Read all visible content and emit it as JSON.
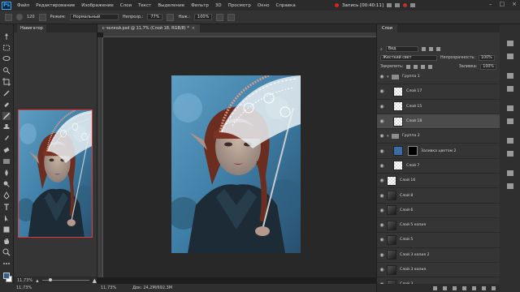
{
  "app": {
    "logo": "Ps"
  },
  "menu": [
    "Файл",
    "Редактирование",
    "Изображение",
    "Слои",
    "Текст",
    "Выделение",
    "Фильтр",
    "3D",
    "Просмотр",
    "Окно",
    "Справка"
  ],
  "recording": {
    "label": "Запись [00:40:11]"
  },
  "options": {
    "mode_label": "Режим:",
    "mode_value": "Нормальный",
    "opacity_label": "Непрозр.:",
    "opacity_value": "77%",
    "pressure_label": "Наж.:",
    "pressure_value": "100%",
    "brush_size": "120"
  },
  "navigator": {
    "tab": "Навигатор",
    "zoom": "11,73%"
  },
  "document": {
    "tab": "с челкой.psd @ 11,7% (Слой 18, RGB/8) *",
    "zoom": "11,73%",
    "doc_size": "Док: 24,2М/692,3М"
  },
  "layers": {
    "tab": "Слои",
    "kind": "Вид",
    "blend": "Жесткий свет",
    "opacity_label": "Непрозрачность:",
    "opacity_value": "100%",
    "lock_label": "Закрепить:",
    "fill_label": "Заливка:",
    "fill_value": "100%",
    "items": [
      {
        "name": "Группа 1",
        "type": "group"
      },
      {
        "name": "Слой 17",
        "type": "layer"
      },
      {
        "name": "Слой 15",
        "type": "layer"
      },
      {
        "name": "Слой 18",
        "type": "layer",
        "selected": true
      },
      {
        "name": "Группа 2",
        "type": "group"
      },
      {
        "name": "Заливка цветом 2",
        "type": "fill"
      },
      {
        "name": "Слой 7",
        "type": "layer"
      },
      {
        "name": "Слой 16",
        "type": "layer"
      },
      {
        "name": "Слой 8",
        "type": "layer"
      },
      {
        "name": "Слой 6",
        "type": "layer"
      },
      {
        "name": "Слой 5 копия",
        "type": "layer"
      },
      {
        "name": "Слой 5",
        "type": "layer"
      },
      {
        "name": "Слой 3 копия 2",
        "type": "layer"
      },
      {
        "name": "Слой 3 копия",
        "type": "layer"
      },
      {
        "name": "Слой 3",
        "type": "layer"
      }
    ]
  },
  "colors": {
    "foreground": "#2f5f8c",
    "background": "#ffffff",
    "accent": "#31a8ff",
    "record": "#e02020"
  }
}
